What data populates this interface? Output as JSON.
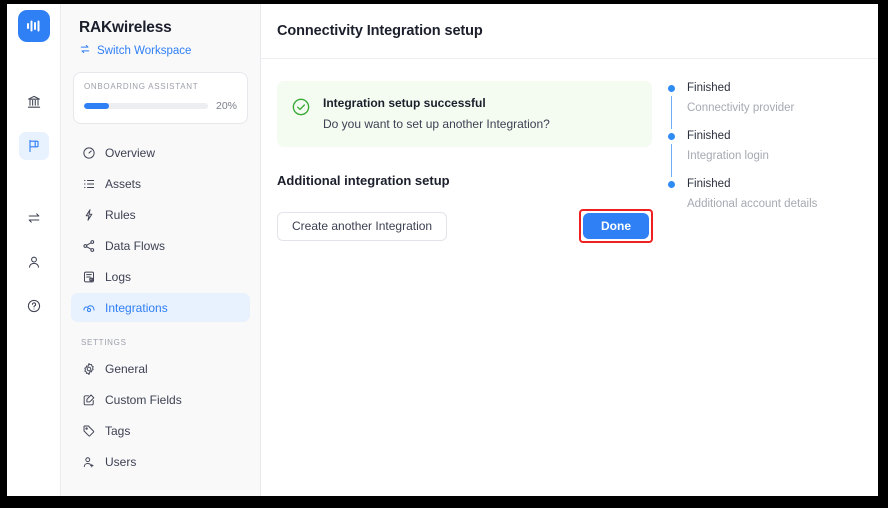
{
  "icon_rail": {
    "logo_name": "app-logo",
    "items": [
      {
        "name": "organization-icon",
        "active": false
      },
      {
        "name": "flag-icon",
        "active": true
      },
      {
        "name": "transfer-icon",
        "active": false
      },
      {
        "name": "user-icon",
        "active": false
      },
      {
        "name": "help-icon",
        "active": false
      }
    ]
  },
  "sidebar": {
    "workspace_name": "RAKwireless",
    "switch_workspace_label": "Switch Workspace",
    "onboarding": {
      "title": "ONBOARDING ASSISTANT",
      "percent_label": "20%",
      "percent_value": 20
    },
    "nav": [
      {
        "label": "Overview",
        "icon": "gauge-icon",
        "active": false
      },
      {
        "label": "Assets",
        "icon": "list-icon",
        "active": false
      },
      {
        "label": "Rules",
        "icon": "bolt-icon",
        "active": false
      },
      {
        "label": "Data Flows",
        "icon": "share-icon",
        "active": false
      },
      {
        "label": "Logs",
        "icon": "logs-icon",
        "active": false
      },
      {
        "label": "Integrations",
        "icon": "cloud-icon",
        "active": true
      }
    ],
    "settings_section_label": "SETTINGS",
    "settings_nav": [
      {
        "label": "General",
        "icon": "gear-icon",
        "active": false
      },
      {
        "label": "Custom Fields",
        "icon": "edit-square-icon",
        "active": false
      },
      {
        "label": "Tags",
        "icon": "tag-icon",
        "active": false
      },
      {
        "label": "Users",
        "icon": "add-user-icon",
        "active": false
      }
    ]
  },
  "main": {
    "page_title": "Connectivity Integration setup",
    "success": {
      "icon": "check-circle-icon",
      "heading": "Integration setup successful",
      "subtext": "Do you want to set up another Integration?"
    },
    "section_heading": "Additional integration setup",
    "secondary_button": "Create another Integration",
    "primary_button": "Done"
  },
  "steps": [
    {
      "status": "Finished",
      "label": "Connectivity provider"
    },
    {
      "status": "Finished",
      "label": "Integration login"
    },
    {
      "status": "Finished",
      "label": "Additional account details"
    }
  ],
  "colors": {
    "accent_blue": "#2f7ff5",
    "active_nav_bg": "#e8f1fe",
    "success_bg": "#f4fcf2",
    "success_green": "#3aaa35",
    "highlight_red": "#ee2020",
    "sidebar_bg": "#f9f9fa"
  }
}
